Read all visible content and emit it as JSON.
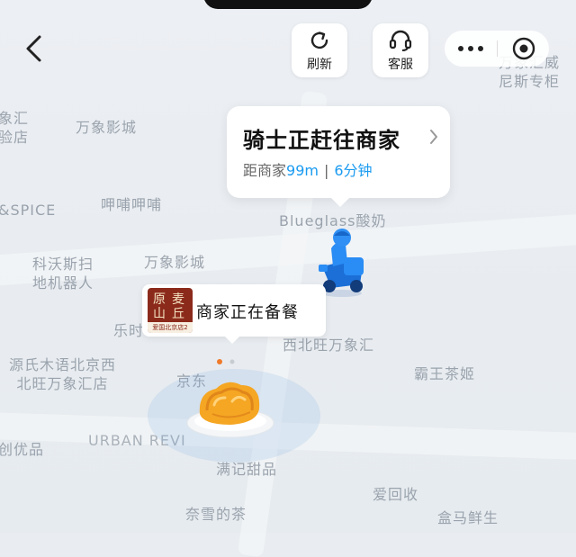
{
  "header": {
    "refresh_label": "刷新",
    "service_label": "客服"
  },
  "status_bubble": {
    "title": "骑士正赶往商家",
    "distance_prefix": "距商家",
    "distance_value": "99m",
    "separator": "|",
    "eta": "6分钟"
  },
  "store": {
    "status_text": "商家正在备餐",
    "logo_text": [
      "原",
      "麦",
      "山",
      "丘"
    ],
    "logo_strip": "爱国北京店2"
  },
  "map_labels": [
    "象汇\n验店",
    "万象影城",
    "&SPICE",
    "呷哺呷哺",
    "Blueglass酸奶",
    "科沃斯扫\n地机器人",
    "万象影城",
    "乐时",
    "西北旺万象汇",
    "源氏木语北京西\n北旺万象汇店",
    "霸王茶姬",
    "京东",
    "URBAN REVI",
    "创优品",
    "满记甜品",
    "爱回收",
    "奈雪的茶",
    "盒马鲜生",
    "万象汇威\n尼斯专柜"
  ],
  "colors": {
    "accent": "#1a9bf0",
    "rider_blue": "#1e88f0",
    "map_bg": "#e9edf1"
  },
  "icons": [
    "back-arrow-icon",
    "refresh-icon",
    "headset-icon",
    "more-dots-icon",
    "target-icon",
    "chevron-right-icon",
    "rider-icon",
    "food-destination-icon"
  ]
}
